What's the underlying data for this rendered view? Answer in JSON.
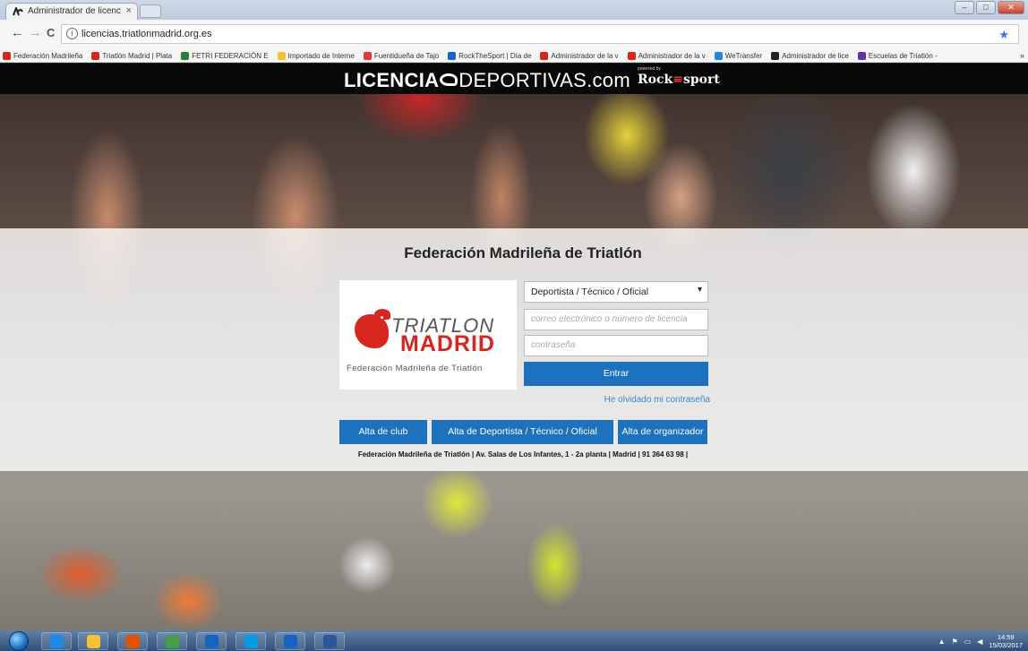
{
  "browser": {
    "tab_title": "Administrador de licenc",
    "tab_close": "×",
    "url": "licencias.triatlonmadrid.org.es",
    "info_glyph": "i",
    "back_glyph": "←",
    "forward_glyph": "→",
    "reload_glyph": "C",
    "star_glyph": "★",
    "bookmarks": [
      {
        "label": "Federación Madrileña",
        "icon": "triatlon-m-icon",
        "color": "#d8261f"
      },
      {
        "label": "Triatlón Madrid | Plata",
        "icon": "triatlon-m-icon",
        "color": "#d8261f"
      },
      {
        "label": "FETRI FEDERACIÓN E",
        "icon": "fetri-icon",
        "color": "#2e7d32"
      },
      {
        "label": "Importado de Interne",
        "icon": "folder-icon",
        "color": "#f4c430"
      },
      {
        "label": "Fuentidueña de Tajo",
        "icon": "fuentiduena-icon",
        "color": "#e53935"
      },
      {
        "label": "RockTheSport | Día de",
        "icon": "rockthesport-icon",
        "color": "#1565c0"
      },
      {
        "label": "Administrador de la v",
        "icon": "triatlon-m-icon",
        "color": "#d8261f"
      },
      {
        "label": "Administrador de la v",
        "icon": "triatlon-m-icon",
        "color": "#d8261f"
      },
      {
        "label": "WeTransfer",
        "icon": "wetransfer-icon",
        "color": "#1e88e5"
      },
      {
        "label": "Administrador de lice",
        "icon": "licencias-icon",
        "color": "#222222"
      },
      {
        "label": "Escuelas de Triatlón -",
        "icon": "escuelas-icon",
        "color": "#5e35b1"
      }
    ],
    "bookmarks_more": "»"
  },
  "brand": {
    "licencia": "LICENCIA",
    "deportivas": "DEPORTIVAS",
    "com": ".com",
    "powered_by": "powered by",
    "rock": "Rock",
    "the": "≡",
    "sport": "sport"
  },
  "org_title": "Federación Madrileña de Triatlón",
  "logo": {
    "triatlon": "TRIATLON",
    "madrid": "MADRID",
    "federation": "Federación Madrileña de Triatlón"
  },
  "login": {
    "role_selected": "Deportista / Técnico / Oficial",
    "select_caret": "▾",
    "email_placeholder": "correo electrónico o número de licencia",
    "password_placeholder": "contraseña",
    "submit": "Entrar",
    "forgot": "He olvidado mi contraseña"
  },
  "signup": {
    "club": "Alta de club",
    "athlete": "Alta de Deportista / Técnico / Oficial",
    "organizer": "Alta de organizador"
  },
  "footer": "Federación Madrileña de Triatlón | Av. Salas de Los Infantes, 1 - 2a planta | Madrid | 91 364 63 98 |",
  "taskbar": {
    "apps": [
      {
        "name": "internet-explorer",
        "color": "#1e88e5"
      },
      {
        "name": "file-explorer",
        "color": "#f4c430"
      },
      {
        "name": "firefox",
        "color": "#e65100"
      },
      {
        "name": "chrome",
        "color": "#43a047"
      },
      {
        "name": "outlook",
        "color": "#1565c0"
      },
      {
        "name": "skype",
        "color": "#039be5"
      },
      {
        "name": "outlook-2",
        "color": "#1565c0"
      },
      {
        "name": "word",
        "color": "#2b579a"
      }
    ],
    "time": "14:59",
    "date": "15/03/2017"
  }
}
